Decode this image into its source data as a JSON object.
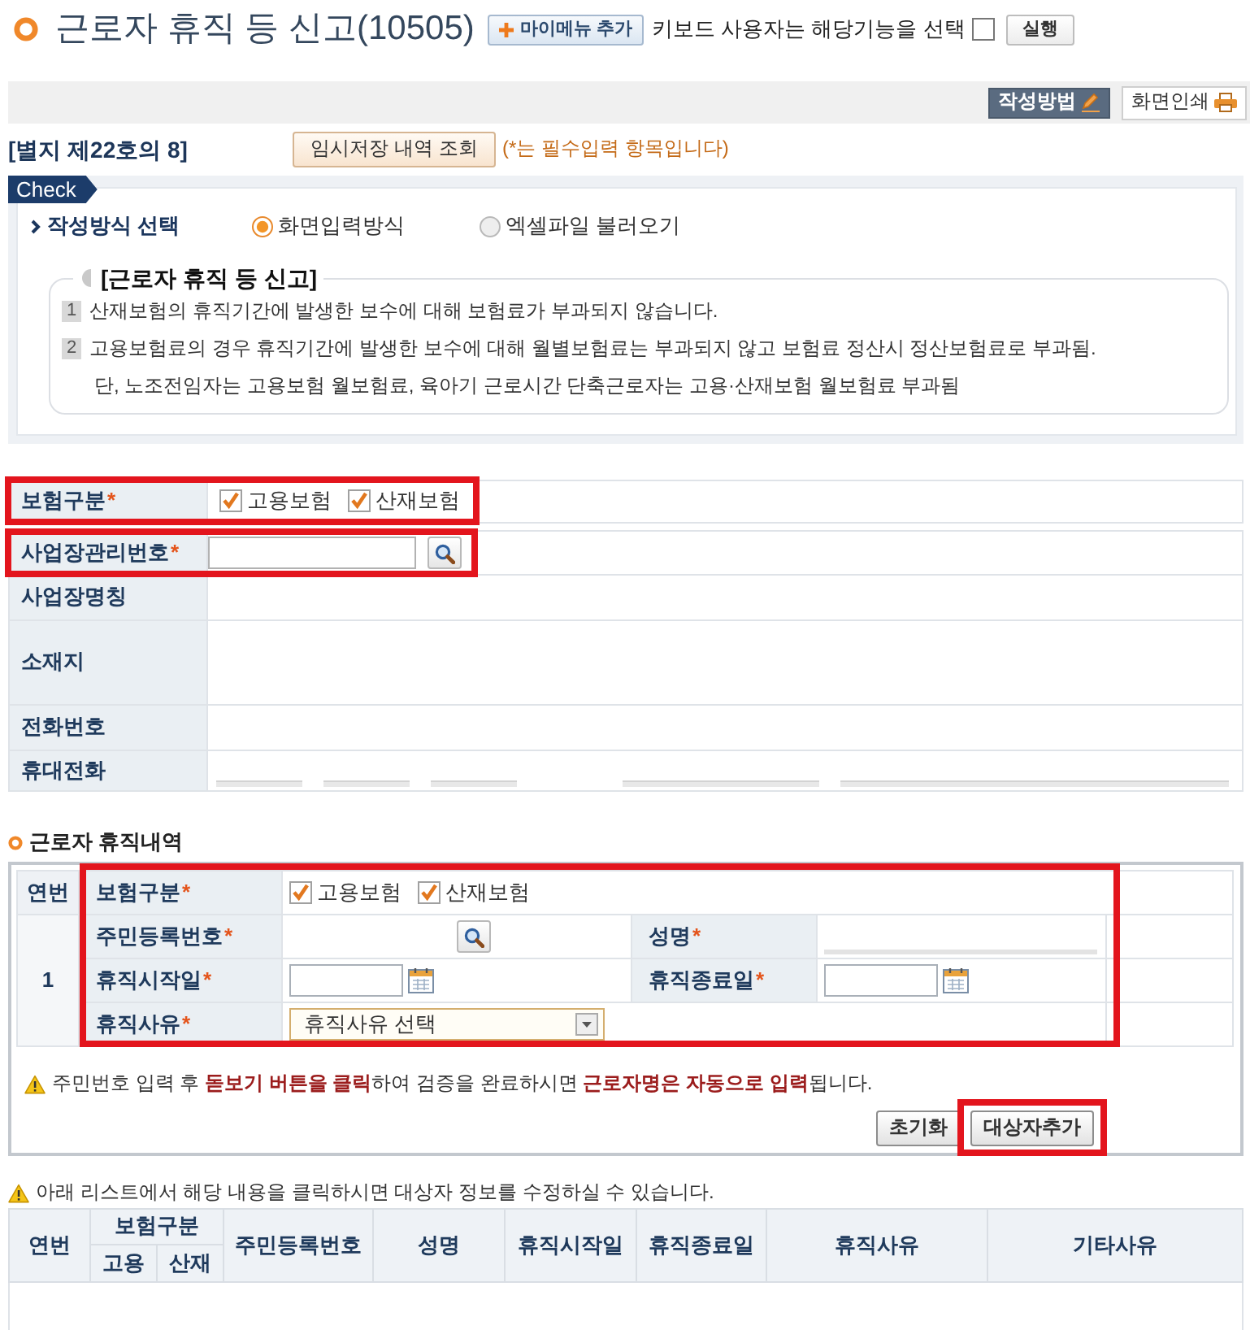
{
  "header": {
    "title": "근로자 휴직 등 신고(10505)",
    "mymenu_button": "마이메뉴 추가",
    "keyboard_label": "키보드 사용자는 해당기능을 선택",
    "keyboard_checkbox": {
      "checked": false
    },
    "run_button": "실행"
  },
  "toolbar": {
    "buttons": [
      {
        "label": "작성방법",
        "kind": "guide"
      },
      {
        "label": "화면인쇄",
        "kind": "print"
      }
    ]
  },
  "form_info": {
    "form_no": "[별지 제22호의 8]",
    "temp_button": "임시저장 내역 조회",
    "required_note": "(*는 필수입력 항목입니다)"
  },
  "check": {
    "tag": "Check",
    "method_label": "작성방식 선택",
    "methods": [
      {
        "label": "화면입력방식",
        "selected": true
      },
      {
        "label": "엑셀파일 불러오기",
        "selected": false
      }
    ],
    "notice_title": "[근로자 휴직 등 신고]",
    "notice_lines": [
      {
        "number": "1",
        "text": "산재보험의 휴직기간에 발생한 보수에 대해 보험료가 부과되지 않습니다."
      },
      {
        "number": "2",
        "text": "고용보험료의 경우 휴직기간에 발생한 보수에 대해 월별보험료는 부과되지 않고 보험료 정산시 정산보험료로 부과됨."
      },
      {
        "text": "단, 노조전임자는 고용보험 월보험료, 육아기 근로시간 단축근로자는 고용·산재보험 월보험료 부과됨"
      }
    ]
  },
  "insurance": {
    "label": "보험구분",
    "required_mark": "*",
    "highlighted": true,
    "options": [
      {
        "label": "고용보험",
        "checked": true
      },
      {
        "label": "산재보험",
        "checked": true
      }
    ]
  },
  "business": [
    {
      "label": "사업장관리번호",
      "required_mark": "*",
      "kind": "search",
      "highlighted": true
    },
    {
      "label": "사업장명칭",
      "kind": "text",
      "highlighted": false
    },
    {
      "label": "소재지",
      "kind": "address",
      "highlighted": false
    },
    {
      "label": "전화번호",
      "kind": "text",
      "highlighted": false
    },
    {
      "label": "휴대전화",
      "kind": "phone",
      "highlighted": false,
      "fields": [
        {
          "kind": "short"
        },
        {
          "kind": "short"
        },
        {
          "kind": "short"
        },
        {
          "kind": "medium"
        },
        {
          "kind": "wide"
        }
      ]
    }
  ],
  "leave": {
    "title": "근로자 휴직내역",
    "highlighted": true,
    "seq_header": "연번",
    "seq": "1",
    "insurance": {
      "label": "보험구분",
      "required_mark": "*",
      "options": [
        {
          "label": "고용보험",
          "checked": true
        },
        {
          "label": "산재보험",
          "checked": true
        }
      ]
    },
    "resident_no": {
      "label": "주민등록번호",
      "required_mark": "*"
    },
    "name": {
      "label": "성명",
      "required_mark": "*"
    },
    "start_date": {
      "label": "휴직시작일",
      "required_mark": "*"
    },
    "end_date": {
      "label": "휴직종료일",
      "required_mark": "*"
    },
    "reason": {
      "label": "휴직사유",
      "required_mark": "*",
      "value": "휴직사유 선택"
    },
    "notice": "주민번호 입력 후 **돋보기 버튼을 클릭**하여 검증을 완료하시면 **근로자명은 자동으로 입력**됩니다.",
    "buttons": [
      {
        "label": "초기화",
        "highlighted": false
      },
      {
        "label": "대상자추가",
        "highlighted": true
      }
    ]
  },
  "list": {
    "notice": "아래 리스트에서 해당 내용을 클릭하시면 대상자 정보를 수정하실 수 있습니다.",
    "columns": [
      {
        "label": "연번"
      },
      {
        "label": "보험구분",
        "children": [
          {
            "label": "고용"
          },
          {
            "label": "산재"
          }
        ]
      },
      {
        "label": "주민등록번호"
      },
      {
        "label": "성명"
      },
      {
        "label": "휴직시작일"
      },
      {
        "label": "휴직종료일"
      },
      {
        "label": "휴직사유"
      },
      {
        "label": "기타사유"
      }
    ]
  }
}
